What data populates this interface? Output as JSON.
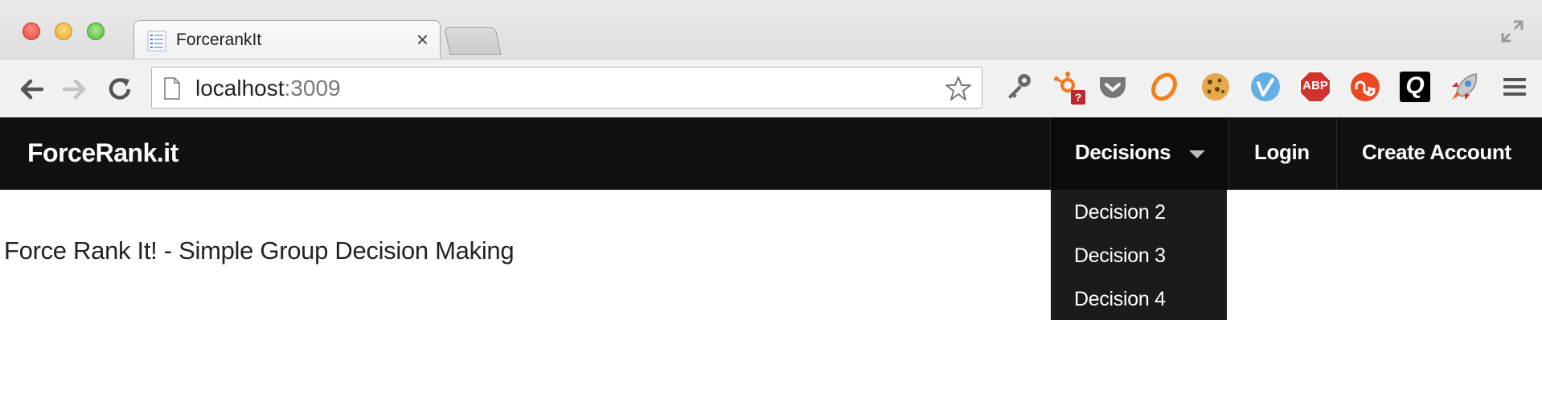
{
  "browser": {
    "tab": {
      "title": "ForcerankIt",
      "close_glyph": "×"
    },
    "url": {
      "host": "localhost",
      "port": ":3009"
    },
    "extensions": [
      {
        "name": "wrench-key-icon"
      },
      {
        "name": "hubspot-icon",
        "badge": "?"
      },
      {
        "name": "pocket-icon"
      },
      {
        "name": "ring-icon"
      },
      {
        "name": "cookie-icon"
      },
      {
        "name": "vimeo-icon"
      },
      {
        "name": "adblock-plus-icon",
        "label": "ABP"
      },
      {
        "name": "stumbleupon-icon"
      },
      {
        "name": "q-icon",
        "label": "Q"
      },
      {
        "name": "rocket-icon"
      },
      {
        "name": "menu-icon"
      }
    ]
  },
  "navbar": {
    "brand": "ForceRank.it",
    "decisions_label": "Decisions",
    "login_label": "Login",
    "create_account_label": "Create Account"
  },
  "dropdown": {
    "items": [
      "Decision 2",
      "Decision 3",
      "Decision 4"
    ]
  },
  "main": {
    "headline": "Force Rank It! - Simple Group Decision Making"
  },
  "colors": {
    "navbar_bg": "#111111",
    "dropdown_bg": "#1b1b1b",
    "abp_red": "#d0342c",
    "hubspot_orange": "#f57722"
  }
}
